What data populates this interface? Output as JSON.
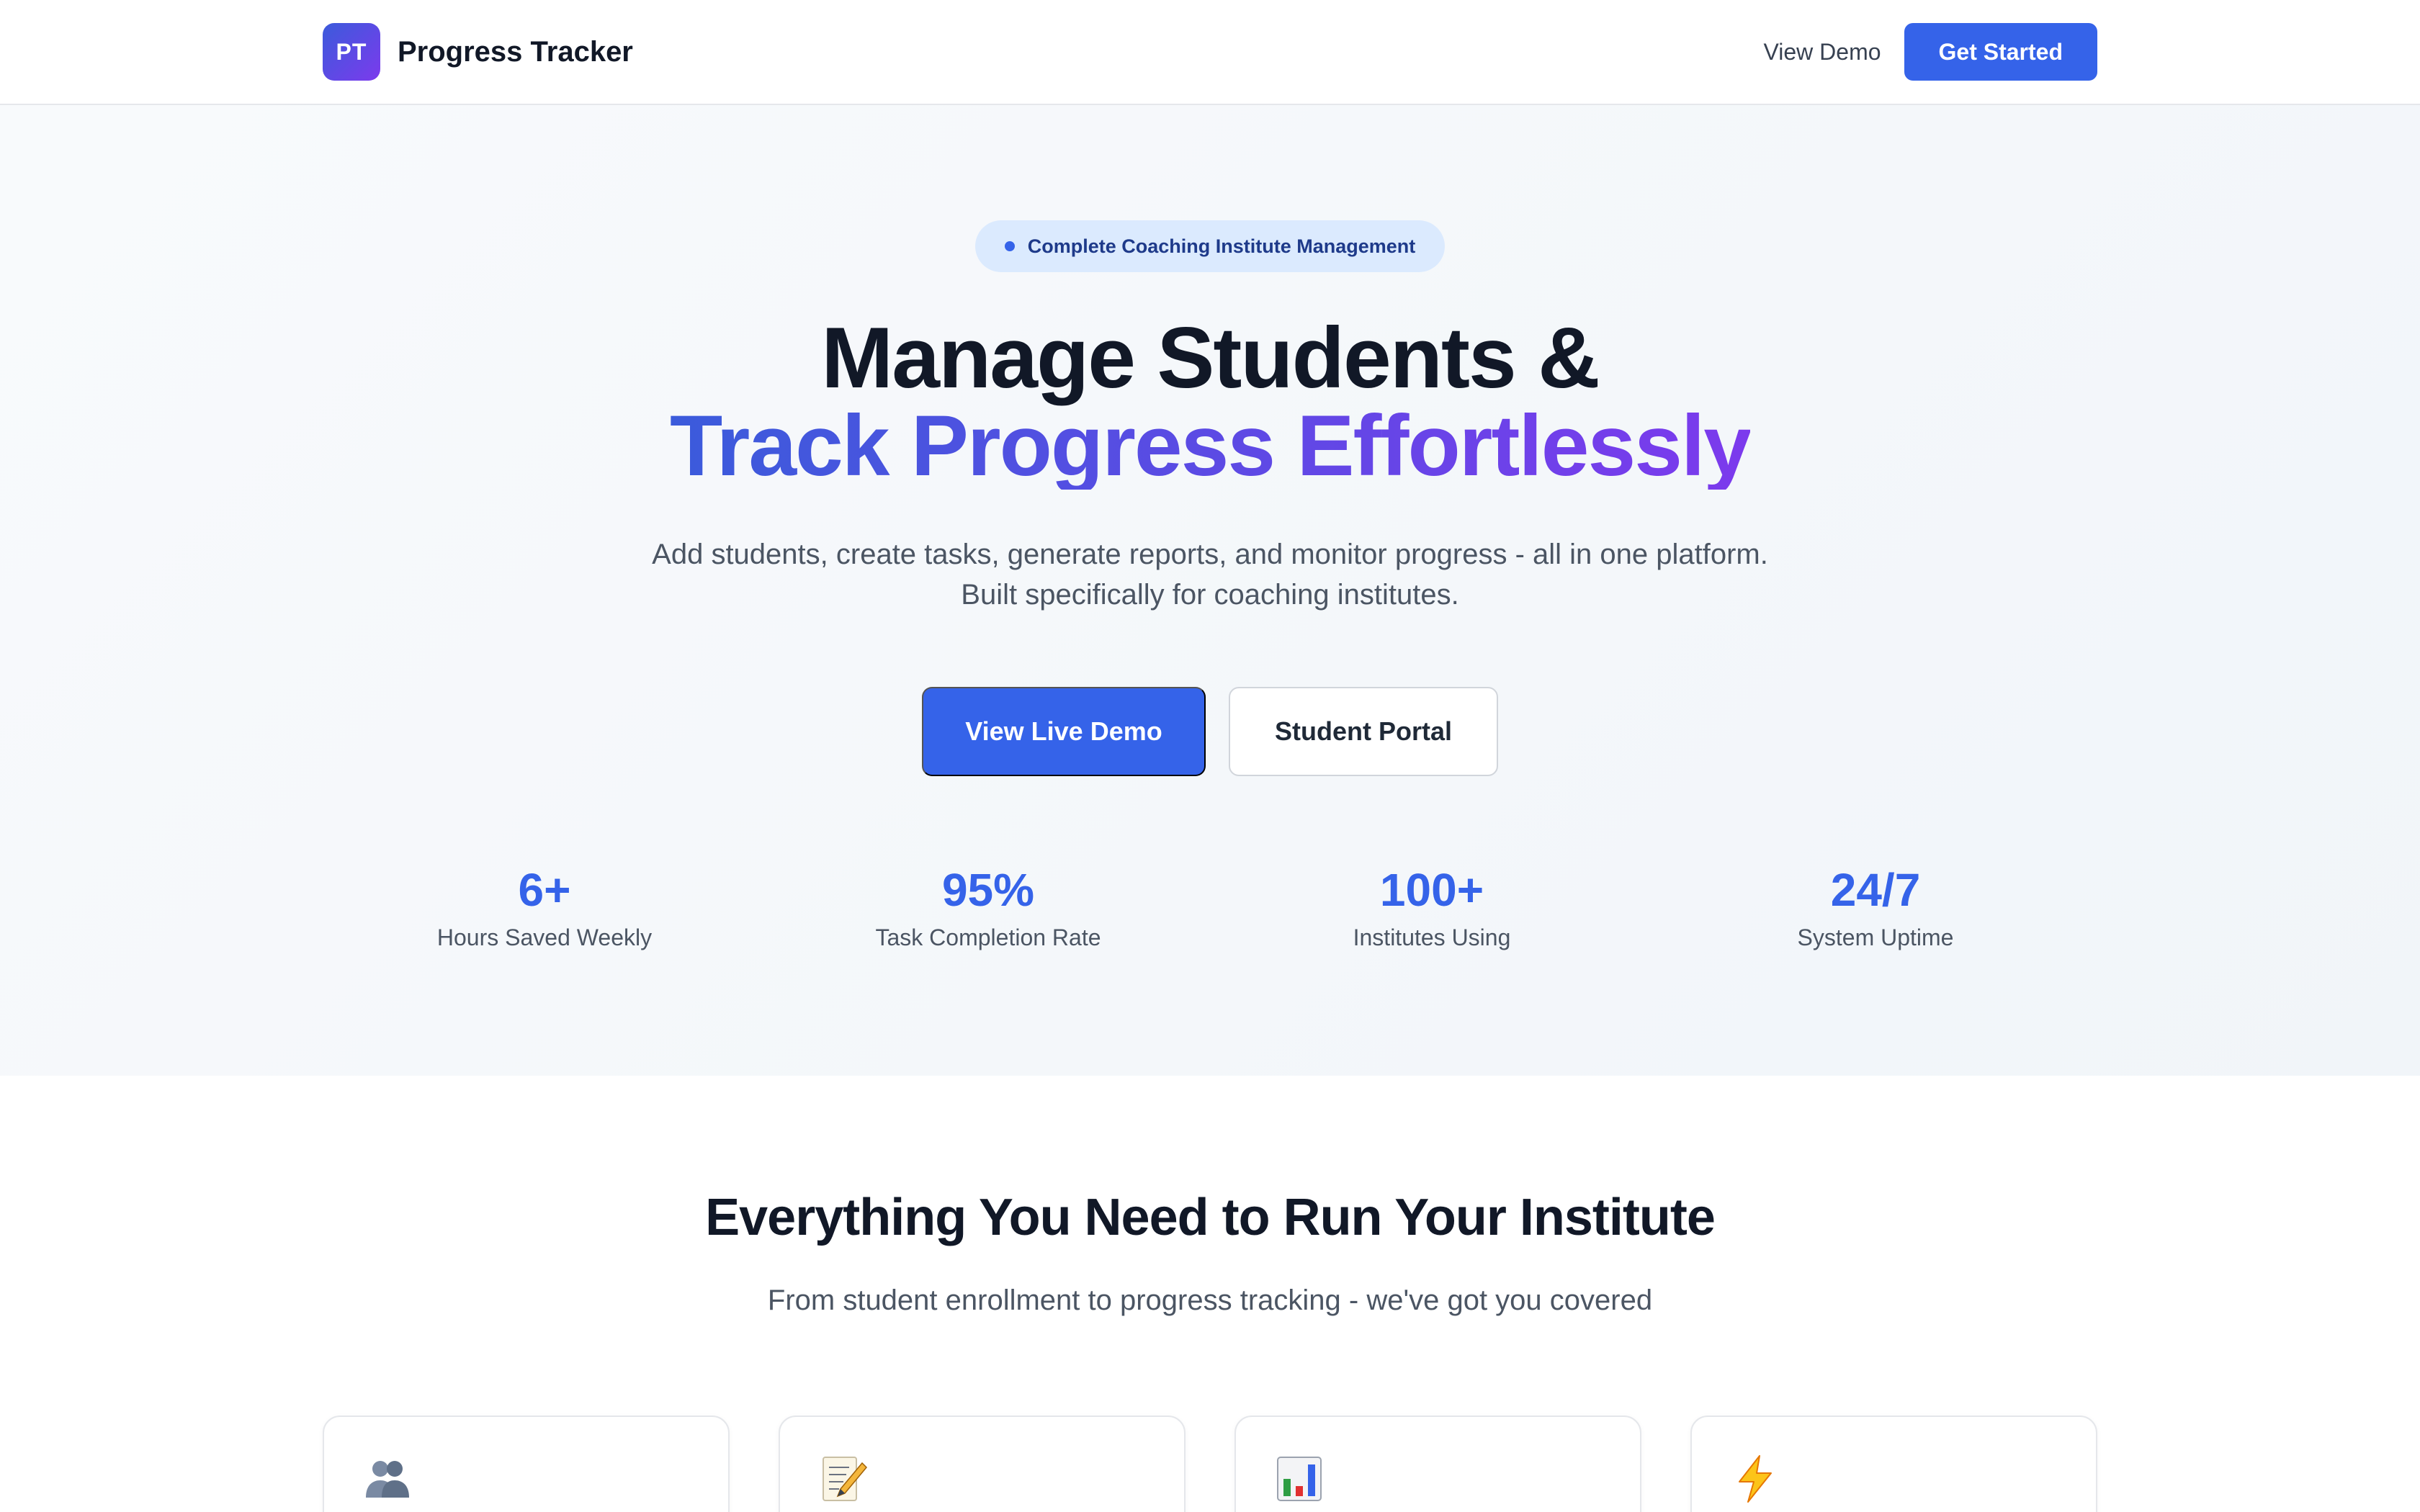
{
  "header": {
    "logo_text": "PT",
    "brand_name": "Progress Tracker",
    "view_demo_label": "View Demo",
    "get_started_label": "Get Started"
  },
  "hero": {
    "badge": "Complete Coaching Institute Management",
    "title_line1": "Manage Students &",
    "title_line2": "Track Progress Effortlessly",
    "subtitle_line1": "Add students, create tasks, generate reports, and monitor progress - all in one platform.",
    "subtitle_line2": "Built specifically for coaching institutes.",
    "primary_cta": "View Live Demo",
    "secondary_cta": "Student Portal",
    "stats": [
      {
        "value": "6+",
        "label": "Hours Saved Weekly"
      },
      {
        "value": "95%",
        "label": "Task Completion Rate"
      },
      {
        "value": "100+",
        "label": "Institutes Using"
      },
      {
        "value": "24/7",
        "label": "System Uptime"
      }
    ]
  },
  "features": {
    "title": "Everything You Need to Run Your Institute",
    "subtitle": "From student enrollment to progress tracking - we've got you covered",
    "cards": [
      {
        "icon": "users-icon"
      },
      {
        "icon": "memo-icon"
      },
      {
        "icon": "bar-chart-icon"
      },
      {
        "icon": "lightning-icon"
      }
    ]
  },
  "colors": {
    "primary": "#3563e9",
    "gradient_start": "#3b5bdb",
    "gradient_end": "#7c3aed"
  }
}
